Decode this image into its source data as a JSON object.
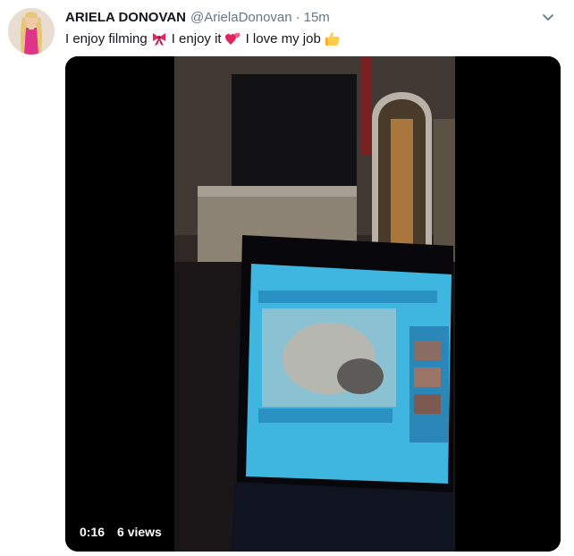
{
  "tweet": {
    "display_name": "ARIELA DONOVAN",
    "handle": "@ArielaDonovan",
    "separator": "·",
    "time": "15m",
    "text_parts": [
      "I enjoy filming",
      "I enjoy it",
      "I love my job"
    ],
    "emojis": [
      "ribbon-emoji",
      "two-hearts-emoji",
      "thumbs-up-emoji"
    ],
    "media": {
      "type": "video",
      "duration": "0:16",
      "views": "6 views"
    }
  },
  "icons": {
    "caret": "chevron-down-icon"
  },
  "colors": {
    "text_primary": "#14171a",
    "text_secondary": "#657786",
    "ribbon": "#e0245e",
    "hearts": "#e0245e",
    "thumb": "#ffcc4d"
  }
}
